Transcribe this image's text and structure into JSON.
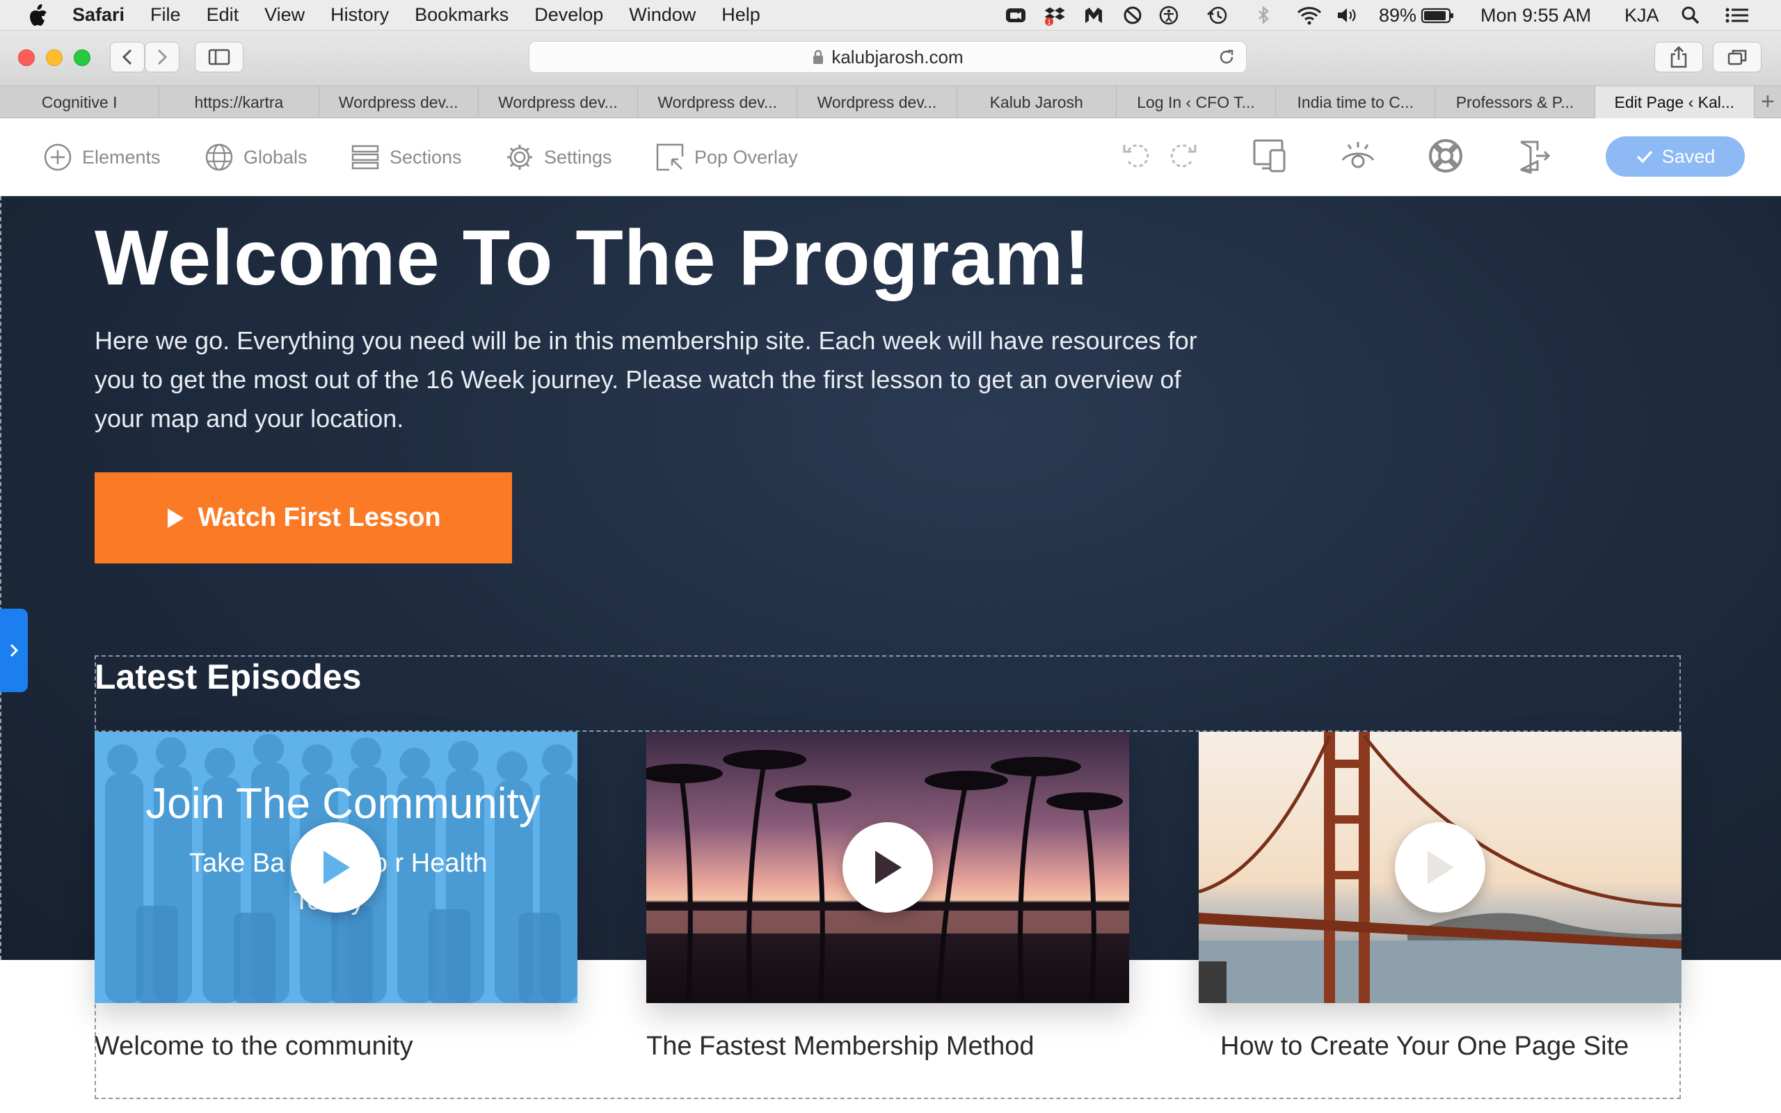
{
  "menubar": {
    "app": "Safari",
    "items": [
      "File",
      "Edit",
      "View",
      "History",
      "Bookmarks",
      "Develop",
      "Window",
      "Help"
    ],
    "battery": "89%",
    "clock": "Mon 9:55 AM",
    "user": "KJA",
    "dropbox_badge": "1"
  },
  "browser": {
    "url": "kalubjarosh.com",
    "tabs": [
      "Cognitive I",
      "https://kartra",
      "Wordpress dev...",
      "Wordpress dev...",
      "Wordpress dev...",
      "Wordpress dev...",
      "Kalub Jarosh",
      "Log In ‹ CFO T...",
      "India time to C...",
      "Professors & P...",
      "Edit Page ‹ Kal..."
    ],
    "active_tab_index": 10
  },
  "builder": {
    "elements": "Elements",
    "globals": "Globals",
    "sections": "Sections",
    "settings": "Settings",
    "pop_overlay": "Pop Overlay",
    "saved": "Saved",
    "accent": "#8db9f5"
  },
  "hero": {
    "title": "Welcome To The Program!",
    "body": "Here we go. Everything you need will be in this membership site. Each week will have resources for you to get the most out of the 16 Week journey. Please watch the first lesson to get an overview of your map and your location.",
    "cta": "Watch First Lesson",
    "cta_color": "#fb7a26"
  },
  "episodes": {
    "heading": "Latest Episodes",
    "items": [
      {
        "label": "Welcome to the community",
        "thumb_title": "Join The Community",
        "thumb_sub_1": "Take Ba",
        "thumb_sub_2": "Yo r Health",
        "thumb_sub_3": "Today"
      },
      {
        "label": "The Fastest Membership Method"
      },
      {
        "label": "How to Create Your One Page Site"
      }
    ]
  }
}
